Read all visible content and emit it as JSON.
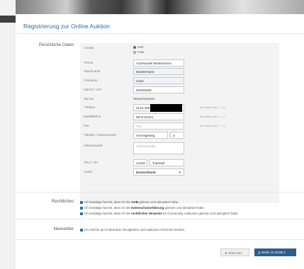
{
  "page": {
    "title": "Registrierung zur Online Auktion",
    "sections": {
      "personal": "Persönliche Daten",
      "legal": "Rechtliches",
      "newsletter": "Newsletter"
    }
  },
  "form": {
    "anrede": {
      "label": "Anrede",
      "options": [
        "Herr",
        "Frau"
      ],
      "selected": "Herr"
    },
    "firma": {
      "label": "*Firma",
      "value": "Autohandel Mustermann"
    },
    "nachname": {
      "label": "*Nachname",
      "value": "Mustermann"
    },
    "vorname": {
      "label": "*Vorname",
      "value": "Hans"
    },
    "ustid": {
      "label": "USt-ID / VAT",
      "value": "DE000000"
    },
    "taxno": {
      "label": "Tax No.",
      "value": "Steuernummer"
    },
    "telefon": {
      "label": "*Telefon",
      "value": "0123-456789",
      "hint": "nur Zahlen und + / - ( )"
    },
    "mobil": {
      "label": "Mobiltelefon",
      "value": "9876-54321",
      "hint": "nur Zahlen und + / - ( )"
    },
    "fax": {
      "label": "Fax",
      "placeholder": "Fax",
      "hint": "nur Zahlen und + / - ( )"
    },
    "strasse": {
      "label": "*Straße / Hausnummer",
      "value": "Vorzeigeweg",
      "number": "3"
    },
    "adresszusatz": {
      "label": "Adresszusatz",
      "placeholder": "Adresszusatz"
    },
    "plz": {
      "label": "*PLZ / Ort",
      "value": "12345",
      "ort": "Topstadt"
    },
    "land": {
      "label": "*Land",
      "value": "Deutschland"
    }
  },
  "legal": {
    "line1": {
      "pre": "Ich bestätige hiermit, dass ich die ",
      "bold": "AGB",
      "post": " gelesen und akzeptiert habe."
    },
    "line2": {
      "pre": "Ich bestätige hiermit, dass ich die ",
      "bold": "Datenschutzerklärung",
      "post": " gelesen und akzeptiert habe."
    },
    "line3": {
      "pre": "Ich bestätige hiermit, dass ich die ",
      "bold": "rechtlichen Hinweise",
      "post": " für Community Auktionen gelesen und akzeptiert habe."
    }
  },
  "newsletter": {
    "text": "Ich möchte per E-Mail über Neuigkeiten und Auktionen informiert werden."
  },
  "buttons": {
    "cancel": "✖ Abbrechen",
    "next": "❯ Weiter zu Schritt 2"
  },
  "colors": {
    "accent": "#2b6fae",
    "primary_button": "#2e5e8f"
  }
}
